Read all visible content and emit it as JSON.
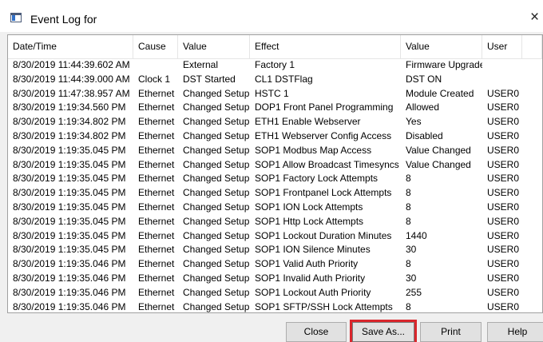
{
  "window": {
    "title": "Event Log for",
    "close_glyph": "×"
  },
  "table": {
    "columns": [
      "Date/Time",
      "Cause",
      "Value",
      "Effect",
      "Value",
      "User",
      ""
    ],
    "rows": [
      [
        "8/30/2019 11:44:39.602 AM",
        "",
        "External",
        "Factory 1",
        "Firmware Upgrade",
        ""
      ],
      [
        "8/30/2019 11:44:39.000 AM",
        "Clock 1",
        "DST Started",
        "CL1 DSTFlag",
        "DST ON",
        ""
      ],
      [
        "8/30/2019 11:47:38.957 AM",
        "Ethernet",
        "Changed Setup",
        "HSTC 1",
        "Module Created",
        "USER0"
      ],
      [
        "8/30/2019 1:19:34.560 PM",
        "Ethernet",
        "Changed Setup",
        "DOP1 Front Panel Programming",
        "Allowed",
        "USER0"
      ],
      [
        "8/30/2019 1:19:34.802 PM",
        "Ethernet",
        "Changed Setup",
        "ETH1 Enable Webserver",
        "Yes",
        "USER0"
      ],
      [
        "8/30/2019 1:19:34.802 PM",
        "Ethernet",
        "Changed Setup",
        "ETH1 Webserver Config Access",
        "Disabled",
        "USER0"
      ],
      [
        "8/30/2019 1:19:35.045 PM",
        "Ethernet",
        "Changed Setup",
        "SOP1 Modbus Map Access",
        "Value Changed",
        "USER0"
      ],
      [
        "8/30/2019 1:19:35.045 PM",
        "Ethernet",
        "Changed Setup",
        "SOP1 Allow Broadcast Timesyncs",
        "Value Changed",
        "USER0"
      ],
      [
        "8/30/2019 1:19:35.045 PM",
        "Ethernet",
        "Changed Setup",
        "SOP1 Factory Lock Attempts",
        "8",
        "USER0"
      ],
      [
        "8/30/2019 1:19:35.045 PM",
        "Ethernet",
        "Changed Setup",
        "SOP1 Frontpanel Lock Attempts",
        "8",
        "USER0"
      ],
      [
        "8/30/2019 1:19:35.045 PM",
        "Ethernet",
        "Changed Setup",
        "SOP1 ION Lock Attempts",
        "8",
        "USER0"
      ],
      [
        "8/30/2019 1:19:35.045 PM",
        "Ethernet",
        "Changed Setup",
        "SOP1 Http Lock Attempts",
        "8",
        "USER0"
      ],
      [
        "8/30/2019 1:19:35.045 PM",
        "Ethernet",
        "Changed Setup",
        "SOP1 Lockout Duration Minutes",
        "1440",
        "USER0"
      ],
      [
        "8/30/2019 1:19:35.045 PM",
        "Ethernet",
        "Changed Setup",
        "SOP1 ION Silence Minutes",
        "30",
        "USER0"
      ],
      [
        "8/30/2019 1:19:35.046 PM",
        "Ethernet",
        "Changed Setup",
        "SOP1 Valid Auth Priority",
        "8",
        "USER0"
      ],
      [
        "8/30/2019 1:19:35.046 PM",
        "Ethernet",
        "Changed Setup",
        "SOP1 Invalid Auth Priority",
        "30",
        "USER0"
      ],
      [
        "8/30/2019 1:19:35.046 PM",
        "Ethernet",
        "Changed Setup",
        "SOP1 Lockout Auth Priority",
        "255",
        "USER0"
      ],
      [
        "8/30/2019 1:19:35.046 PM",
        "Ethernet",
        "Changed Setup",
        "SOP1 SFTP/SSH Lock Attempts",
        "8",
        "USER0"
      ]
    ],
    "scroll_down_glyph": "▼"
  },
  "buttons": {
    "close": "Close",
    "save_as": "Save As...",
    "print": "Print",
    "help": "Help"
  },
  "colors": {
    "highlight_border": "#d9262c",
    "list_background": "#ffffff",
    "dialog_background": "#f0f0f0"
  }
}
